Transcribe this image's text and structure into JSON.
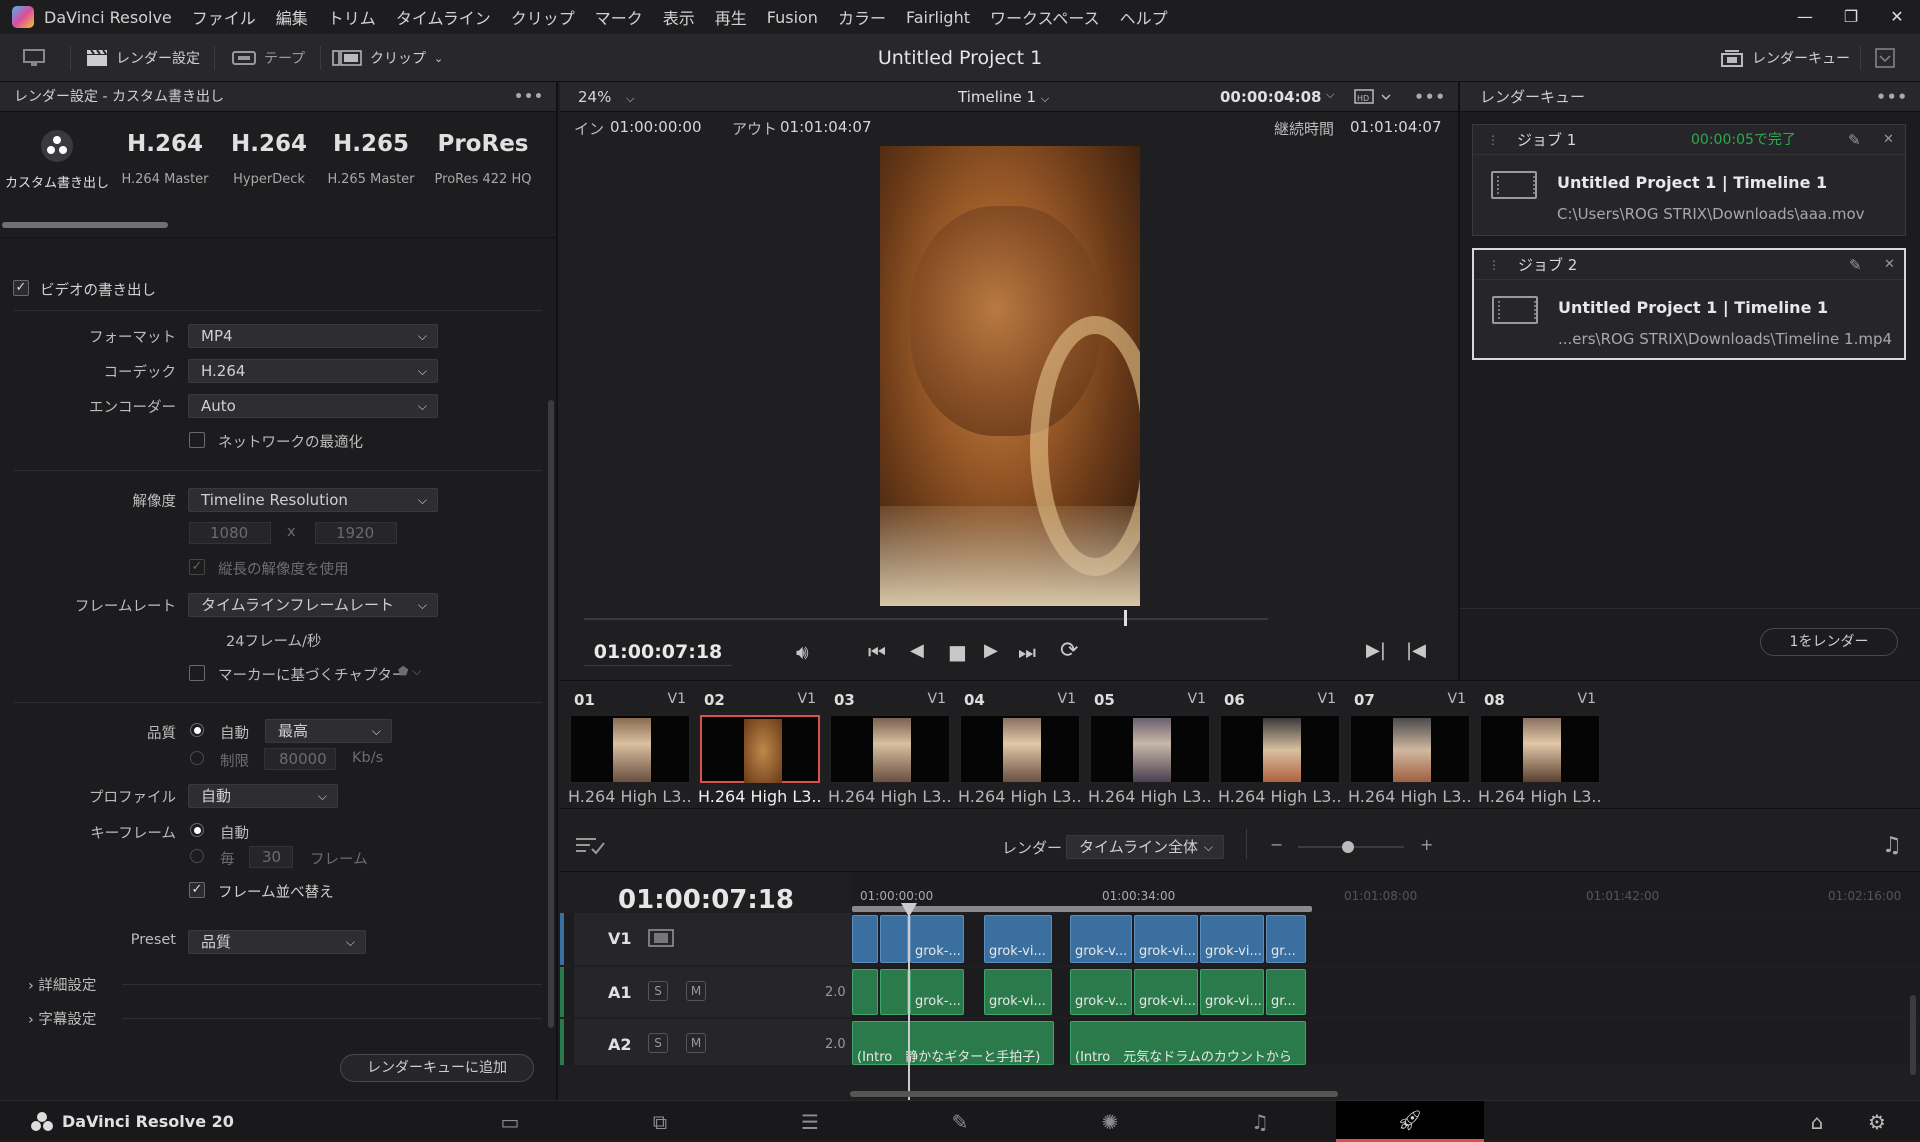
{
  "menubar": {
    "app_name": "DaVinci Resolve",
    "items": [
      "ファイル",
      "編集",
      "トリム",
      "タイムライン",
      "クリップ",
      "マーク",
      "表示",
      "再生",
      "Fusion",
      "カラー",
      "Fairlight",
      "ワークスペース",
      "ヘルプ"
    ]
  },
  "toolbar": {
    "render_settings": "レンダー設定",
    "tape": "テープ",
    "clips": "クリップ",
    "project_title": "Untitled Project 1",
    "render_queue": "レンダーキュー"
  },
  "render_settings": {
    "header": "レンダー設定 - カスタム書き出し",
    "presets": [
      {
        "big": "",
        "label": "カスタム書き出し"
      },
      {
        "big": "H.264",
        "label": "H.264 Master"
      },
      {
        "big": "H.264",
        "label": "HyperDeck"
      },
      {
        "big": "H.265",
        "label": "H.265 Master"
      },
      {
        "big": "ProRes",
        "label": "ProRes 422 HQ"
      }
    ],
    "export_video": "ビデオの書き出し",
    "format_label": "フォーマット",
    "format": "MP4",
    "codec_label": "コーデック",
    "codec": "H.264",
    "encoder_label": "エンコーダー",
    "encoder": "Auto",
    "network_opt": "ネットワークの最適化",
    "resolution_label": "解像度",
    "resolution": "Timeline Resolution",
    "width": "1080",
    "x": "x",
    "height": "1920",
    "use_vertical": "縦長の解像度を使用",
    "framerate_label": "フレームレート",
    "framerate": "タイムラインフレームレート",
    "fps": "24フレーム/秒",
    "chapters": "マーカーに基づくチャプター",
    "quality_label": "品質",
    "auto": "自動",
    "quality": "最高",
    "limit": "制限",
    "bitrate": "80000",
    "kbs": "Kb/s",
    "profile_label": "プロファイル",
    "profile": "自動",
    "keyframe_label": "キーフレーム",
    "kf_auto": "自動",
    "kf_every": "毎",
    "kf_value": "30",
    "kf_unit": "フレーム",
    "frame_reorder": "フレーム並べ替え",
    "preset_label": "Preset",
    "preset": "品質",
    "advanced": "詳細設定",
    "subtitles": "字幕設定",
    "add_queue": "レンダーキューに追加"
  },
  "viewer": {
    "zoom": "24%",
    "timeline": "Timeline 1",
    "timecode": "00:00:04:08",
    "in_label": "イン",
    "in": "01:00:00:00",
    "out_label": "アウト",
    "out": "01:01:04:07",
    "dur_label": "継続時間",
    "dur": "01:01:04:07",
    "current": "01:00:07:18",
    "scrub_position": 0.79
  },
  "render_queue": {
    "header": "レンダーキュー",
    "jobs": [
      {
        "name": "ジョブ 1",
        "status": "00:00:05で完了",
        "title": "Untitled Project 1 | Timeline 1",
        "path": "C:\\Users\\ROG STRIX\\Downloads\\aaa.mov"
      },
      {
        "name": "ジョブ 2",
        "status": "",
        "title": "Untitled Project 1 | Timeline 1",
        "path": "...ers\\ROG STRIX\\Downloads\\Timeline 1.mp4"
      }
    ],
    "render_button": "1をレンダー"
  },
  "clips": [
    {
      "num": "01",
      "track": "V1",
      "caption": "H.264 High L3..."
    },
    {
      "num": "02",
      "track": "V1",
      "caption": "H.264 High L3..."
    },
    {
      "num": "03",
      "track": "V1",
      "caption": "H.264 High L3..."
    },
    {
      "num": "04",
      "track": "V1",
      "caption": "H.264 High L3..."
    },
    {
      "num": "05",
      "track": "V1",
      "caption": "H.264 High L3..."
    },
    {
      "num": "06",
      "track": "V1",
      "caption": "H.264 High L3..."
    },
    {
      "num": "07",
      "track": "V1",
      "caption": "H.264 High L3..."
    },
    {
      "num": "08",
      "track": "V1",
      "caption": "H.264 High L3..."
    }
  ],
  "timeline": {
    "render_label": "レンダー",
    "render_scope": "タイムライン全体",
    "timecode": "01:00:07:18",
    "ruler": [
      "01:00:00:00",
      "01:00:34:00",
      "01:01:08:00",
      "01:01:42:00",
      "01:02:16:00"
    ],
    "tracks": [
      "V1",
      "A1",
      "A2"
    ],
    "level": "2.0",
    "s": "S",
    "m": "M",
    "vclips": [
      "grok-...",
      "grok-vi...",
      "grok-v...",
      "grok-vi...",
      "grok-vi...",
      "gr..."
    ],
    "a1clips": [
      "grok-...",
      "grok-vi...",
      "grok-v...",
      "grok-vi...",
      "grok-vi...",
      "gr..."
    ],
    "a2clips": [
      "(Intro　静かなギターと手拍子)",
      "(Intro　元気なドラムのカウントから　ノリ"
    ]
  },
  "footer": {
    "brand": "DaVinci Resolve 20"
  }
}
